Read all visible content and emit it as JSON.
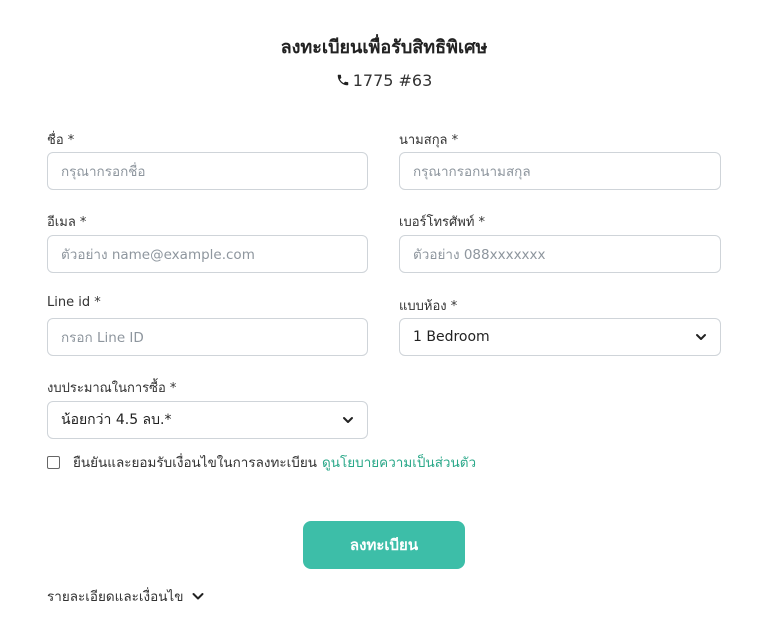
{
  "header": {
    "title": "ลงทะเบียนเพื่อรับสิทธิพิเศษ",
    "phone": "1775 #63",
    "phone_icon": "phone-icon"
  },
  "form": {
    "first_name": {
      "label": "ชื่อ *",
      "placeholder": "กรุณากรอกชื่อ"
    },
    "last_name": {
      "label": "นามสกุล *",
      "placeholder": "กรุณากรอกนามสกุล"
    },
    "email": {
      "label": "อีเมล *",
      "placeholder": "ตัวอย่าง name@example.com"
    },
    "phone_number": {
      "label": "เบอร์โทรศัพท์ *",
      "placeholder": "ตัวอย่าง 088xxxxxxx"
    },
    "line_id": {
      "label": "Line id *",
      "placeholder": "กรอก Line ID"
    },
    "room_type": {
      "label": "แบบห้อง *",
      "selected": "1 Bedroom"
    },
    "budget": {
      "label": "งบประมาณในการซื้อ *",
      "selected": "น้อยกว่า 4.5 ลบ.*"
    },
    "consent": {
      "text": "ยืนยันและยอมรับเงื่อนไขในการลงทะเบียน",
      "link": "ดูนโยบายความเป็นส่วนตัว",
      "checked": false
    },
    "submit_label": "ลงทะเบียน"
  },
  "footer": {
    "details_label": "รายละเอียดและเงื่อนไข"
  },
  "colors": {
    "accent": "#3dbea8",
    "link": "#2aa889",
    "border": "#cfd4d9"
  }
}
